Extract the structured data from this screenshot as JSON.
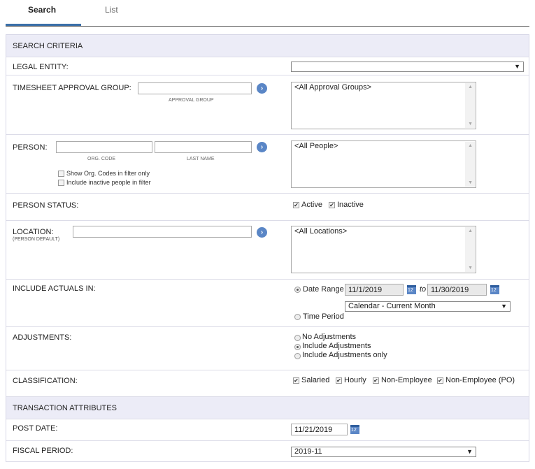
{
  "tabs": {
    "search": "Search",
    "list": "List"
  },
  "search_criteria": {
    "header": "SEARCH CRITERIA",
    "legal_entity": {
      "label": "LEGAL ENTITY:",
      "value": ""
    },
    "approval_group": {
      "label": "TIMESHEET APPROVAL GROUP:",
      "input_hint": "APPROVAL GROUP",
      "list_items": [
        "<All Approval Groups>"
      ]
    },
    "person": {
      "label": "PERSON:",
      "org_code_hint": "ORG. CODE",
      "last_name_hint": "LAST NAME",
      "show_org_codes": "Show Org. Codes in filter only",
      "include_inactive": "Include inactive people in filter",
      "list_items": [
        "<All People>"
      ]
    },
    "person_status": {
      "label": "PERSON STATUS:",
      "active": "Active",
      "inactive": "Inactive"
    },
    "location": {
      "label": "LOCATION:",
      "sublabel": "(PERSON DEFAULT)",
      "list_items": [
        "<All Locations>"
      ]
    },
    "include_actuals": {
      "label": "INCLUDE ACTUALS IN:",
      "date_range": "Date Range",
      "from": "11/1/2019",
      "to_word": "to",
      "to": "11/30/2019",
      "period_select": "Calendar - Current Month",
      "time_period": "Time Period"
    },
    "adjustments": {
      "label": "ADJUSTMENTS:",
      "options": [
        "No Adjustments",
        "Include Adjustments",
        "Include Adjustments only"
      ],
      "selected": "Include Adjustments"
    },
    "classification": {
      "label": "CLASSIFICATION:",
      "options": [
        "Salaried",
        "Hourly",
        "Non-Employee",
        "Non-Employee (PO)"
      ]
    }
  },
  "transaction_attributes": {
    "header": "TRANSACTION ATTRIBUTES",
    "post_date": {
      "label": "POST DATE:",
      "value": "11/21/2019"
    },
    "fiscal_period": {
      "label": "FISCAL PERIOD:",
      "value": "2019-11"
    }
  },
  "icons": {
    "go": "arrow-right-icon",
    "calendar": "calendar-icon",
    "dropdown": "chevron-down-icon"
  }
}
